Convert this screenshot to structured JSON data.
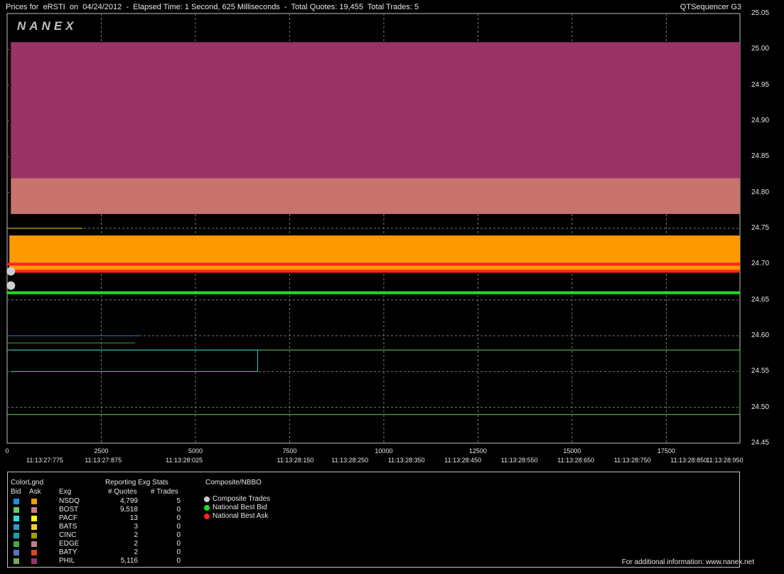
{
  "header": {
    "title": "Prices for  eRSTI  on  04/24/2012  -  Elapsed Time: 1 Second, 625 Milliseconds  -  Total Quotes: 19,455  Total Trades: 5",
    "app_name": "QTSequencer G3"
  },
  "watermark": "NANEX",
  "chart_data": {
    "type": "line",
    "y_ticks": [
      "25.05",
      "25.00",
      "24.95",
      "24.90",
      "24.85",
      "24.80",
      "24.75",
      "24.70",
      "24.65",
      "24.60",
      "24.55",
      "24.50",
      "24.45"
    ],
    "ylim": [
      24.45,
      25.05
    ],
    "xlim": [
      0,
      19455
    ],
    "x_ticks": [
      {
        "x": 0,
        "label": "0"
      },
      {
        "x": 2500,
        "label": "2500"
      },
      {
        "x": 5000,
        "label": "5000"
      },
      {
        "x": 7500,
        "label": "7500"
      },
      {
        "x": 10000,
        "label": "10000"
      },
      {
        "x": 12500,
        "label": "12500"
      },
      {
        "x": 15000,
        "label": "15000"
      },
      {
        "x": 17500,
        "label": "17500"
      }
    ],
    "time_labels": [
      {
        "x": 1000,
        "label": "11:13:27:775"
      },
      {
        "x": 2550,
        "label": "11:13:27:875"
      },
      {
        "x": 4700,
        "label": "11:13:28:025"
      },
      {
        "x": 7650,
        "label": "11:13:28:150"
      },
      {
        "x": 9100,
        "label": "11:13:28:250"
      },
      {
        "x": 10600,
        "label": "11:13:28:350"
      },
      {
        "x": 12100,
        "label": "11:13:28:450"
      },
      {
        "x": 13600,
        "label": "11:13:28:550"
      },
      {
        "x": 15100,
        "label": "11:13:28:650"
      },
      {
        "x": 16600,
        "label": "11:13:28:750"
      },
      {
        "x": 18100,
        "label": "11:13:28:850"
      },
      {
        "x": 19050,
        "label": "11:13:28:950"
      }
    ],
    "series": [
      {
        "name": "PHIL Ask",
        "color": "#993366",
        "band": [
          24.82,
          25.01
        ],
        "x": [
          100,
          19455
        ]
      },
      {
        "name": "PHIL Bid",
        "color": "#c8736e",
        "band": [
          24.77,
          24.82
        ],
        "x": [
          100,
          19455
        ]
      },
      {
        "name": "NSDQ Ask",
        "color": "#ff9900",
        "band": [
          24.69,
          24.74
        ],
        "x": [
          60,
          19455
        ]
      },
      {
        "name": "National Best Ask",
        "color": "#ff2222",
        "value": [
          24.7,
          24.69
        ],
        "x": [
          0,
          19455
        ]
      },
      {
        "name": "National Best Bid",
        "color": "#22dd22",
        "value": [
          24.66
        ],
        "x": [
          0,
          19455
        ]
      },
      {
        "name": "BOST Bid",
        "color": "#66cc66",
        "value": [
          24.58,
          24.49
        ],
        "x": [
          0,
          19455
        ]
      },
      {
        "name": "NSDQ Bid",
        "color": "#33cccc",
        "value": [
          24.58,
          24.55
        ],
        "x": [
          100,
          6650
        ]
      },
      {
        "name": "BATY Bid",
        "color": "#5577bb",
        "value": [
          24.6
        ],
        "x": [
          0,
          3500
        ]
      },
      {
        "name": "EDGE Bid",
        "color": "#44aa44",
        "value": [
          24.59
        ],
        "x": [
          0,
          3400
        ]
      },
      {
        "name": "PACF Ask",
        "color": "#ffdd00",
        "value": [
          24.75
        ],
        "x": [
          0,
          2000
        ]
      }
    ],
    "trades": [
      {
        "x": 100,
        "price": 24.69
      },
      {
        "x": 100,
        "price": 24.67
      }
    ]
  },
  "legend": {
    "color_legend_title": "ColorLgnd",
    "bid_label": "Bid",
    "ask_label": "Ask",
    "stats_title": "Reporting Exg Stats",
    "exg_label": "Exg",
    "quotes_label": "# Quotes",
    "trades_label": "# Trades",
    "nbbo_title": "Composite/NBBO",
    "rows": [
      {
        "exg": "NSDQ",
        "quotes": "4,799",
        "trades": "5",
        "bid_color": "#1a8fe0",
        "ask_color": "#ff9900"
      },
      {
        "exg": "BOST",
        "quotes": "9,518",
        "trades": "0",
        "bid_color": "#66cc66",
        "ask_color": "#d07a7a"
      },
      {
        "exg": "PACF",
        "quotes": "13",
        "trades": "0",
        "bid_color": "#33dddd",
        "ask_color": "#ffff00"
      },
      {
        "exg": "BATS",
        "quotes": "3",
        "trades": "0",
        "bid_color": "#3399cc",
        "ask_color": "#ffcc33"
      },
      {
        "exg": "CINC",
        "quotes": "2",
        "trades": "0",
        "bid_color": "#1aa3a3",
        "ask_color": "#a0a000"
      },
      {
        "exg": "EDGE",
        "quotes": "2",
        "trades": "0",
        "bid_color": "#44aa44",
        "ask_color": "#c08080"
      },
      {
        "exg": "BATY",
        "quotes": "2",
        "trades": "0",
        "bid_color": "#5577bb",
        "ask_color": "#dd4422"
      },
      {
        "exg": "PHIL",
        "quotes": "5,116",
        "trades": "0",
        "bid_color": "#77aa55",
        "ask_color": "#993366"
      }
    ],
    "nbbo": [
      {
        "label": "Composite Trades",
        "color": "#cccccc"
      },
      {
        "label": "National Best Bid",
        "color": "#22dd22"
      },
      {
        "label": "National Best Ask",
        "color": "#ff2222"
      }
    ]
  },
  "footer": "For additional information: www.nanex.net"
}
